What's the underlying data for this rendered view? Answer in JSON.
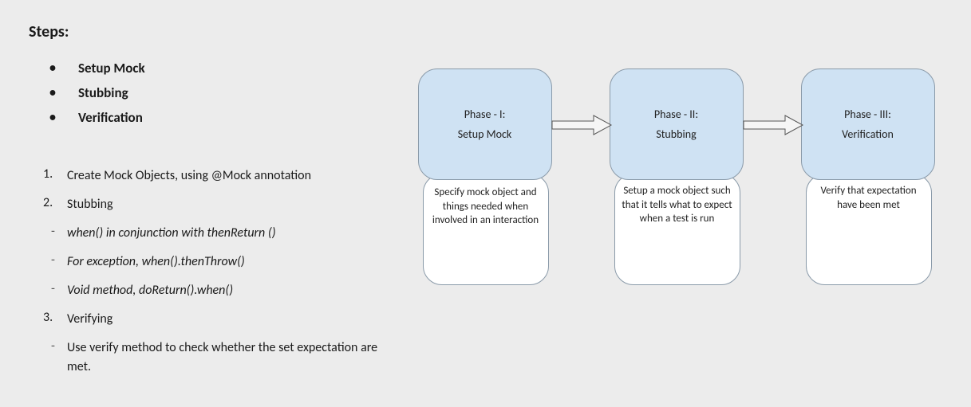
{
  "heading": "Steps:",
  "bullets": {
    "item1": "Setup Mock",
    "item2": "Stubbing",
    "item3": "Verification"
  },
  "steps": {
    "n1": {
      "num": "1.",
      "text": "Create Mock Objects, using @Mock annotation"
    },
    "n2": {
      "num": "2.",
      "text": "Stubbing"
    },
    "s2a": "when() in conjunction with thenReturn ()",
    "s2b": "For exception, when().thenThrow()",
    "s2c": "Void method, doReturn().when()",
    "n3": {
      "num": "3.",
      "text": "Verifying"
    },
    "s3a": "Use verify method to check whether the set expectation are met."
  },
  "diagram": {
    "phase1": {
      "title": "Phase - I:",
      "subtitle": "Setup Mock",
      "desc": "Specify mock object and things needed when involved in an interaction"
    },
    "phase2": {
      "title": "Phase - II:",
      "subtitle": "Stubbing",
      "desc": "Setup a mock object such that it tells what to expect when a test is run"
    },
    "phase3": {
      "title": "Phase - III:",
      "subtitle": "Verification",
      "desc": "Verify that expectation have been met"
    }
  }
}
